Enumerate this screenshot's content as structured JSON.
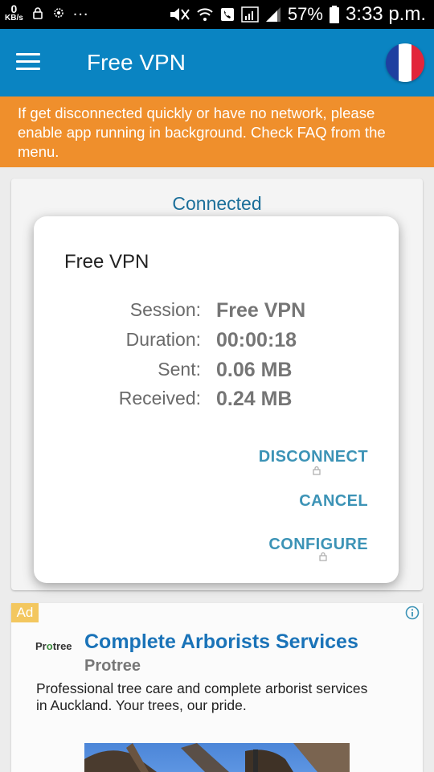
{
  "status_bar": {
    "kbs_value": "0",
    "kbs_unit": "KB/s",
    "dots": "...",
    "battery_percent": "57%",
    "time": "3:33 p.m."
  },
  "app_bar": {
    "title": "Free VPN",
    "flag_icon": "france-flag-icon",
    "flag_colors": [
      "#1e3fa0",
      "#ffffff",
      "#e2253a"
    ]
  },
  "banner": {
    "text": "If get disconnected quickly or have no network, please enable app running in background. Check FAQ from the menu."
  },
  "status_card": {
    "status": "Connected"
  },
  "dialog": {
    "title": "Free VPN",
    "rows": [
      {
        "label": "Session:",
        "value": "Free VPN"
      },
      {
        "label": "Duration:",
        "value": "00:00:18"
      },
      {
        "label": "Sent:",
        "value": "0.06 MB"
      },
      {
        "label": "Received:",
        "value": "0.24 MB"
      }
    ],
    "buttons": {
      "disconnect": "DISCONNECT",
      "cancel": "CANCEL",
      "configure": "CONFIGURE"
    }
  },
  "ad": {
    "badge": "Ad",
    "logo_prefix": "Pr",
    "logo_o": "o",
    "logo_suffix": "tree",
    "headline": "Complete Arborists Services",
    "advertiser": "Protree",
    "body": "Professional tree care and complete arborist services in Auckland. Your trees, our pride."
  },
  "colors": {
    "app_bar": "#0a84c2",
    "banner": "#ef8f2c",
    "accent": "#3c93b6"
  }
}
